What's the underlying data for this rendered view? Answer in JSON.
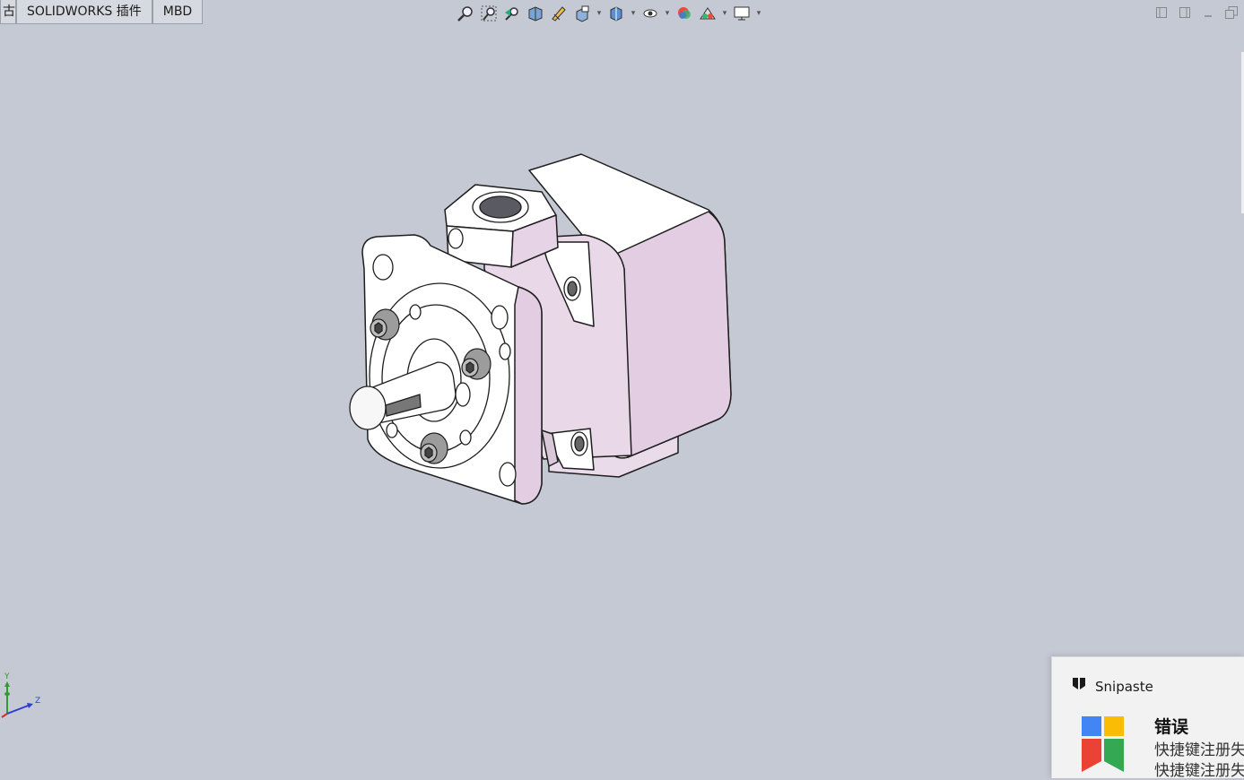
{
  "tabs": {
    "partial": "古",
    "addins": "SOLIDWORKS 插件",
    "mbd": "MBD"
  },
  "toolbar": {
    "icons": [
      "zoom-to-fit-icon",
      "zoom-to-area-icon",
      "previous-view-icon",
      "section-view-icon",
      "dynamic-annotation-icon",
      "view-orientation-icon",
      "display-style-icon",
      "hide-show-items-icon",
      "edit-appearance-icon",
      "apply-scene-icon",
      "view-settings-icon"
    ]
  },
  "triad": {
    "y": "Y",
    "z": "Z"
  },
  "notification": {
    "app_name": "Snipaste",
    "title": "错误",
    "line1": "快捷键注册失",
    "line2": "快捷键注册失"
  },
  "colors": {
    "viewport_bg": "#c5c9d3",
    "part_tint": "#e2cde3",
    "part_edge": "#1e1e1e"
  }
}
